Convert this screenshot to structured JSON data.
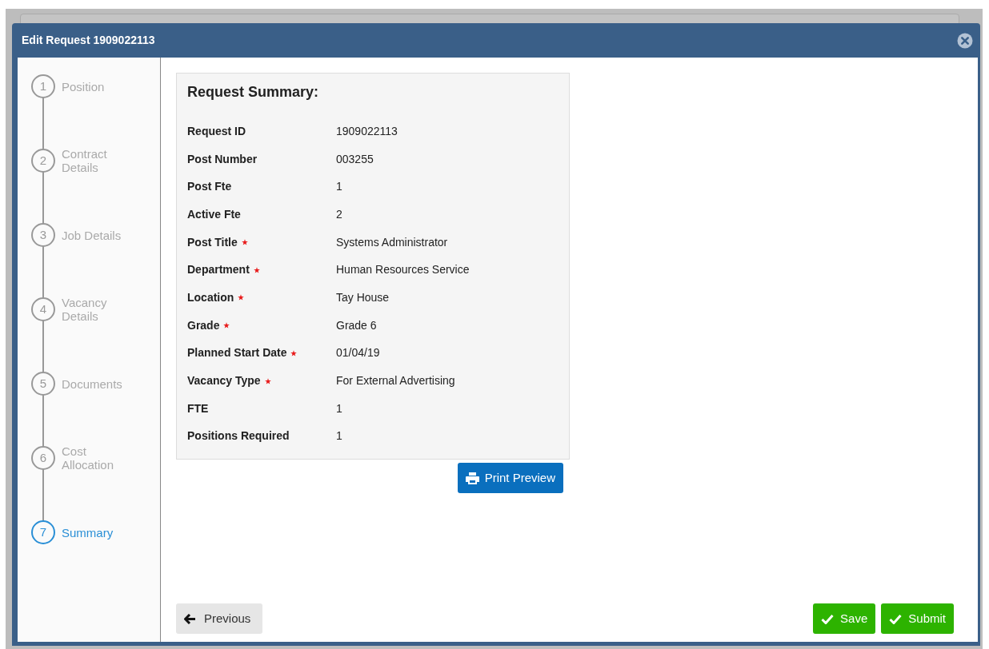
{
  "dialog": {
    "title": "Edit Request 1909022113"
  },
  "steps": [
    {
      "number": "1",
      "label": "Position",
      "selected": false
    },
    {
      "number": "2",
      "label": "Contract Details",
      "selected": false
    },
    {
      "number": "3",
      "label": "Job Details",
      "selected": false
    },
    {
      "number": "4",
      "label": "Vacancy Details",
      "selected": false
    },
    {
      "number": "5",
      "label": "Documents",
      "selected": false
    },
    {
      "number": "6",
      "label": "Cost Allocation",
      "selected": false
    },
    {
      "number": "7",
      "label": "Summary",
      "selected": true
    }
  ],
  "summary": {
    "title": "Request Summary:",
    "rows": [
      {
        "label": "Request ID",
        "value": "1909022113",
        "required": false
      },
      {
        "label": "Post Number",
        "value": "003255",
        "required": false
      },
      {
        "label": "Post Fte",
        "value": "1",
        "required": false
      },
      {
        "label": "Active Fte",
        "value": "2",
        "required": false
      },
      {
        "label": "Post Title",
        "value": "Systems Administrator",
        "required": true
      },
      {
        "label": "Department",
        "value": "Human Resources Service",
        "required": true
      },
      {
        "label": "Location",
        "value": "Tay House",
        "required": true
      },
      {
        "label": "Grade",
        "value": "Grade 6",
        "required": true
      },
      {
        "label": "Planned Start Date",
        "value": "01/04/19",
        "required": true
      },
      {
        "label": "Vacancy Type",
        "value": "For External Advertising",
        "required": true
      },
      {
        "label": "FTE",
        "value": "1",
        "required": false
      },
      {
        "label": "Positions Required",
        "value": "1",
        "required": false
      }
    ]
  },
  "print_button": "Print Preview",
  "footer": {
    "previous": "Previous",
    "save": "Save",
    "submit": "Submit"
  }
}
